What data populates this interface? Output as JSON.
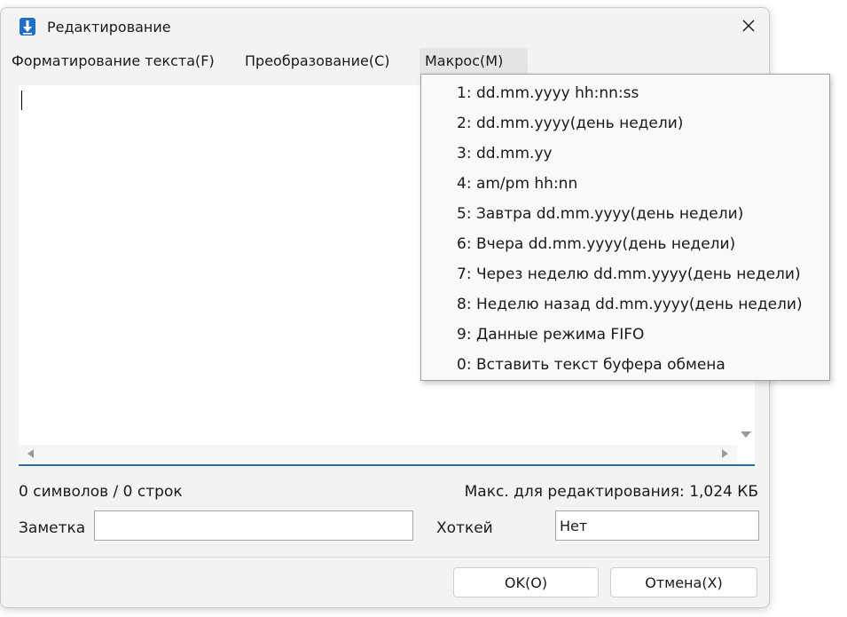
{
  "window": {
    "title": "Редактирование",
    "icon": "download-arrow-icon",
    "accent": "#1f6fc6"
  },
  "menubar": {
    "items": [
      {
        "label": "Форматирование текста(F)"
      },
      {
        "label": "Преобразование(C)"
      },
      {
        "label": "Макрос(M)"
      }
    ]
  },
  "macro_menu": {
    "items": [
      {
        "label": "1: dd.mm.yyyy hh:nn:ss"
      },
      {
        "label": "2: dd.mm.yyyy(день недели)"
      },
      {
        "label": "3: dd.mm.yy"
      },
      {
        "label": "4: am/pm hh:nn"
      },
      {
        "label": "5: Завтра dd.mm.yyyy(день недели)"
      },
      {
        "label": "6: Вчера dd.mm.yyyy(день недели)"
      },
      {
        "label": "7: Через неделю dd.mm.yyyy(день недели)"
      },
      {
        "label": "8: Неделю назад dd.mm.yyyy(день недели)"
      },
      {
        "label": "9: Данные режима FIFO"
      },
      {
        "label": "0: Вставить текст буфера обмена"
      }
    ]
  },
  "status": {
    "counts": "0 символов / 0 строк",
    "max_size": "Макс. для редактирования: 1,024 КБ"
  },
  "fields": {
    "note_label": "Заметка",
    "note_value": "",
    "hotkey_label": "Хоткей",
    "hotkey_value": "Нет"
  },
  "buttons": {
    "ok": "OK(O)",
    "cancel": "Отмена(X)"
  }
}
